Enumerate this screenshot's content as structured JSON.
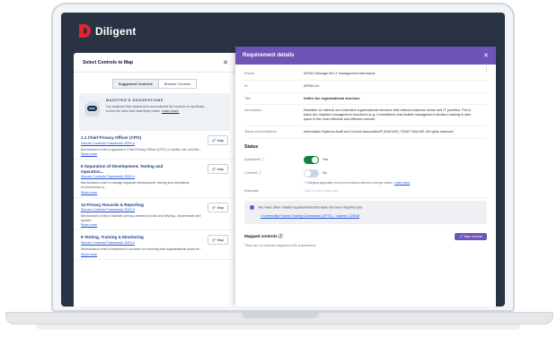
{
  "app": {
    "brand": "Diligent"
  },
  "left_panel": {
    "title": "Select Controls to Map",
    "tabs": [
      "Suggested Controls",
      "Browse Controls"
    ],
    "maestro": {
      "title": "MAESTRO'S SUGGESTIONS",
      "text": "I've analyzed this requirement and scanned the controls in my library to find the ones that most likely match.",
      "link": "Learn more."
    },
    "map_label": "Map",
    "show_more": "Show more",
    "controls": [
      {
        "title": "1.1 Chief Privacy Officer (CPO)",
        "framework": "Secure Controls Framework 2020.4",
        "desc": "Mechanisms exist to appoints a Chief Privacy Officer (CPO) or similar role, and the..."
      },
      {
        "title": "8 Separation of Development, Testing and Operation...",
        "framework": "Secure Controls Framework 2020.4",
        "desc": "Mechanisms exist to manage separate development, testing and operations environments to..."
      },
      {
        "title": "14 Privacy Records & Reporting",
        "framework": "Secure Controls Framework 2020.4",
        "desc": "Mechanisms exist to maintain privacy-related records and develop, disseminate and update..."
      },
      {
        "title": "8 Testing, Training & Monitoring",
        "framework": "Secure Controls Framework 2020.4",
        "desc": "Mechanisms exist to implement a process for ensuring that organizational plans for..."
      }
    ]
  },
  "right_panel": {
    "title": "Requirement details",
    "fields": [
      {
        "label": "Parent",
        "value": "APO01 Manage the IT management framework",
        "bold": false
      },
      {
        "label": "ID",
        "value": "APO01.01",
        "bold": false
      },
      {
        "label": "Title",
        "value": "Define the organizational structure",
        "bold": true
      },
      {
        "label": "Description",
        "value": "Establish an internal and extended organizational structure that reflects business needs and IT priorities. Put in place the required management structures (e.g. Committees) that enable management decision making to take place in the most effective and efficient manner.",
        "bold": false
      },
      {
        "label": "Terms and conditions",
        "value": "Information Systems Audit and Control Association® (ISACA®), ©2007 ISACA®. All rights reserved.",
        "bold": false
      }
    ],
    "status": {
      "title": "Status",
      "applicable": {
        "label": "Applicable",
        "state": "Yes",
        "on": true
      },
      "covered": {
        "label": "Covered",
        "state": "No",
        "on": false
      },
      "hint": "Changing applicable and covered status affects coverage values.",
      "hint_link": "Learn more",
      "rationale_label": "Rationale",
      "rationale_placeholder": "Click to add a rationale"
    },
    "info": {
      "text": "You have other related requirements that have not been imported yet",
      "link": "Commodity Futures Trading Commission (CFTC) - Volume 1 (2016)"
    },
    "mapped": {
      "title": "Mapped controls",
      "button": "Map controls",
      "empty": "There are no controls mapped to this requirement."
    }
  }
}
